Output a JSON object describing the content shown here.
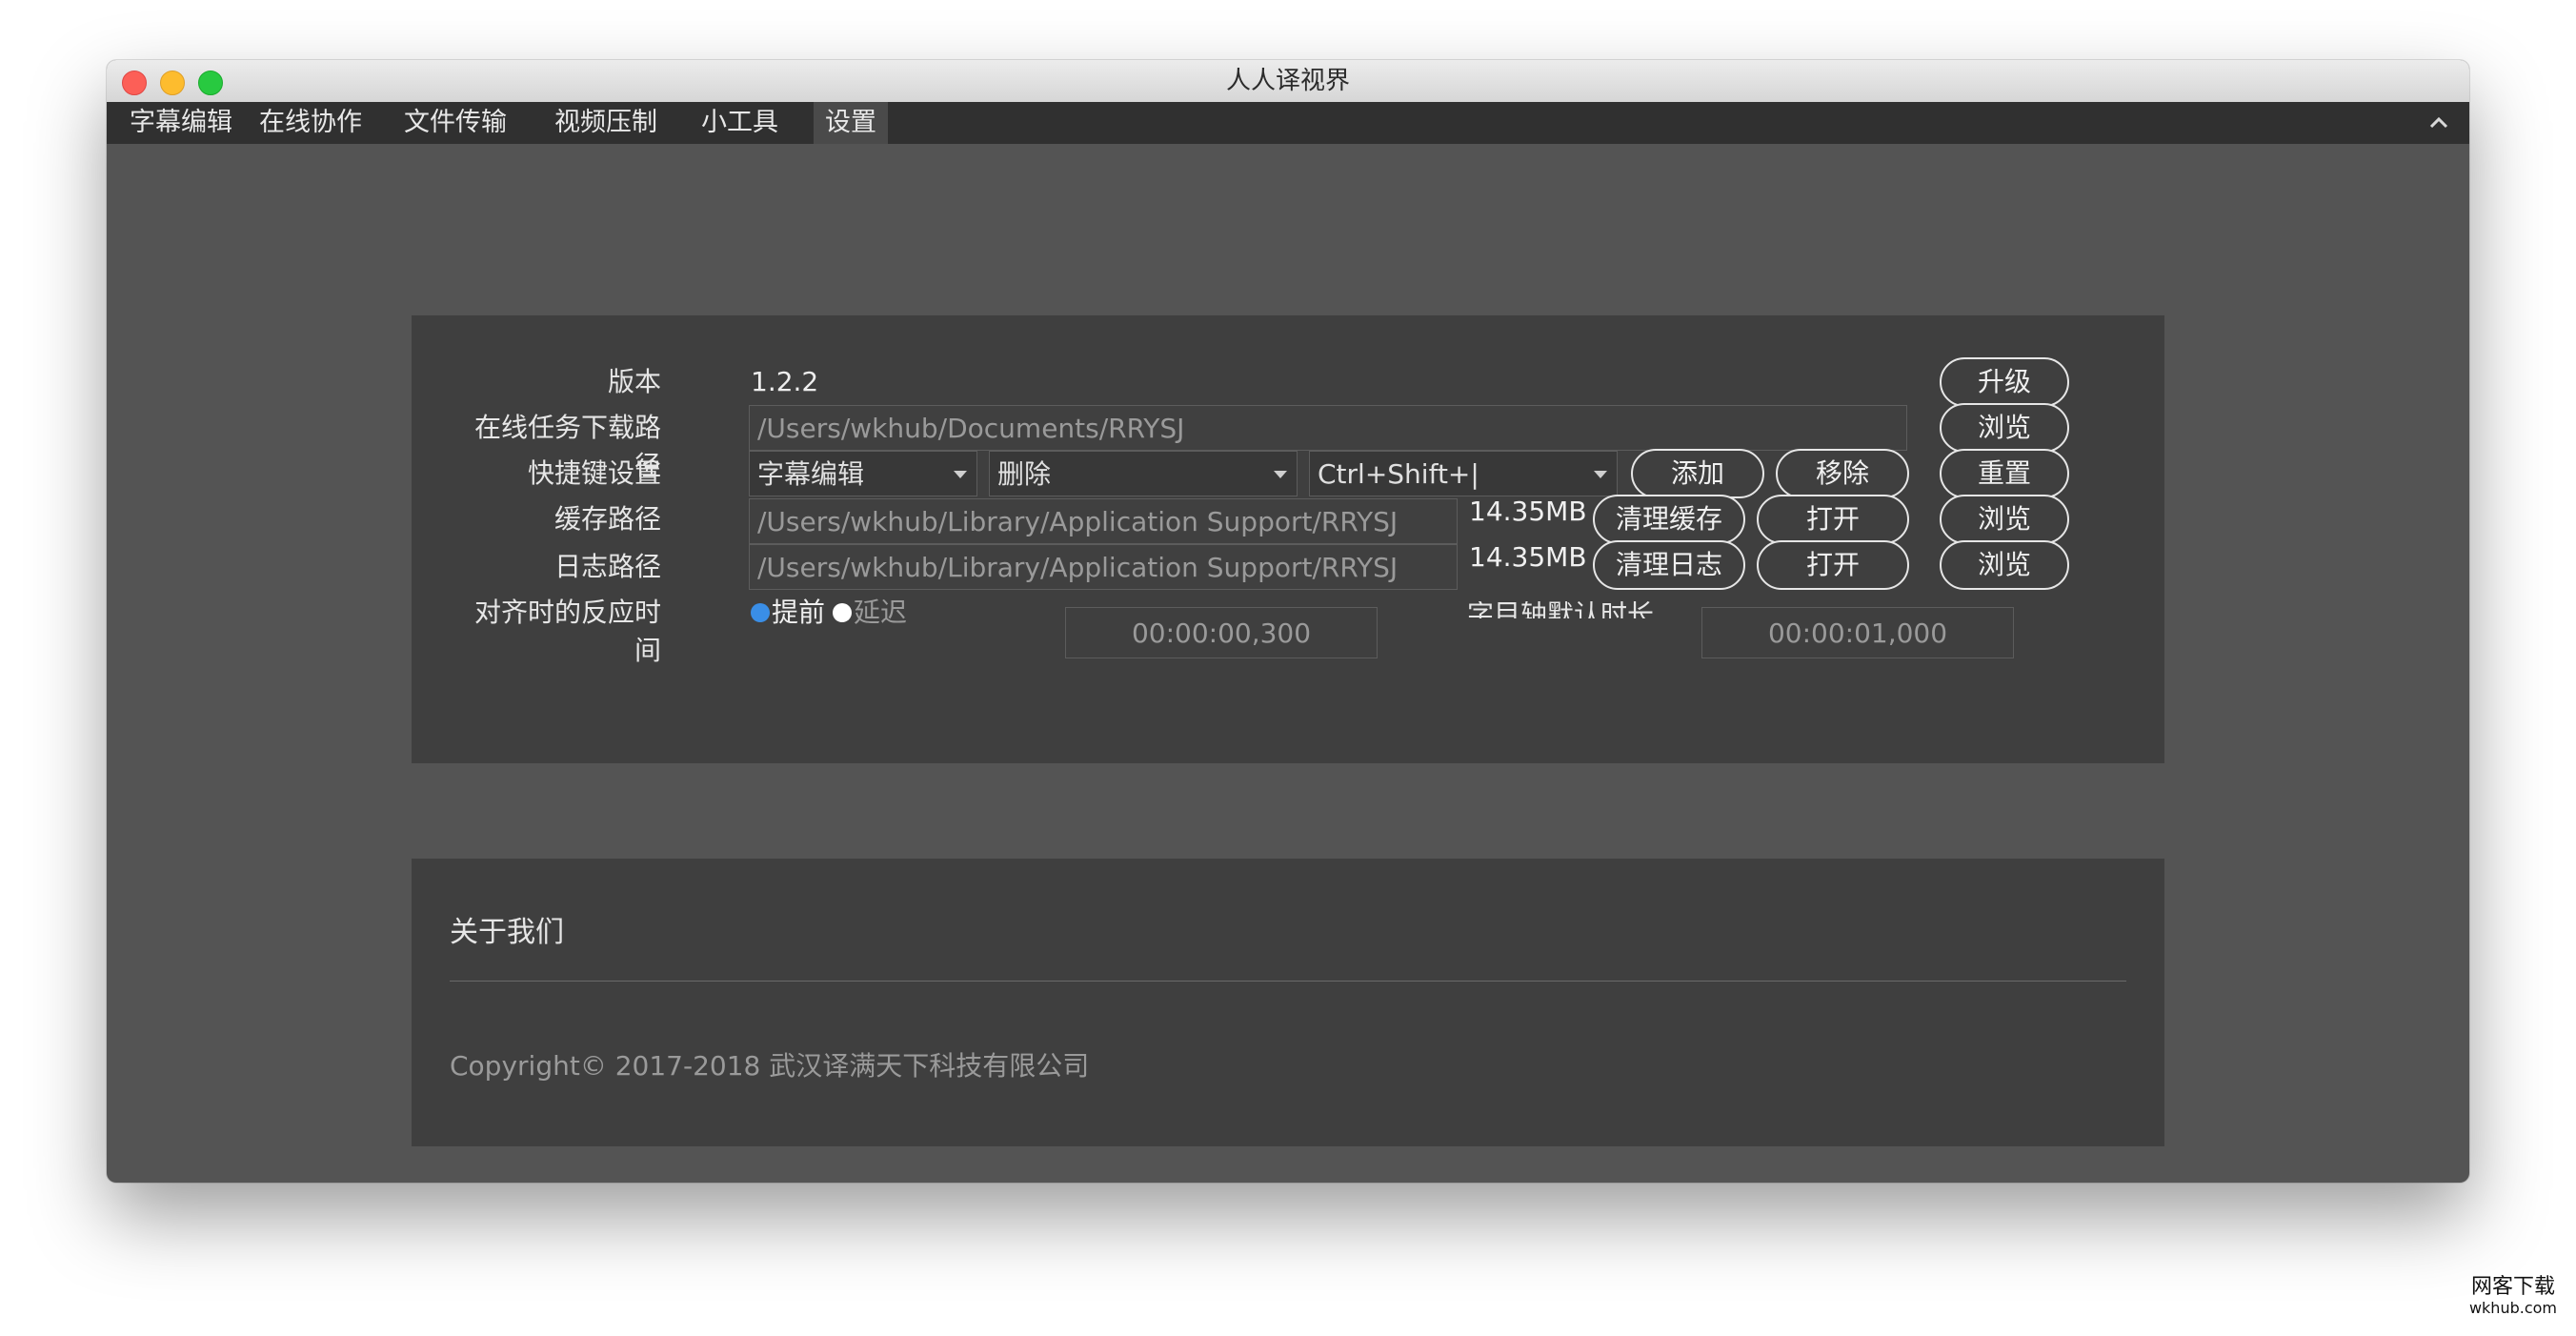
{
  "window": {
    "title": "人人译视界"
  },
  "menu": {
    "items": [
      "字幕编辑",
      "在线协作",
      "文件传输",
      "视频压制",
      "小工具",
      "设置"
    ],
    "active": "设置"
  },
  "settings": {
    "version_label": "版本",
    "version_value": "1.2.2",
    "upgrade_button": "升级",
    "download_path_label": "在线任务下载路径",
    "download_path_value": "/Users/wkhub/Documents/RRYSJ",
    "download_browse_button": "浏览",
    "shortcut_label": "快捷键设置",
    "shortcut_module": "字幕编辑",
    "shortcut_action": "删除",
    "shortcut_keys": "Ctrl+Shift+|",
    "shortcut_add_button": "添加",
    "shortcut_remove_button": "移除",
    "shortcut_reset_button": "重置",
    "cache_path_label": "缓存路径",
    "cache_path_value": "/Users/wkhub/Library/Application Support/RRYSJ",
    "cache_size": "14.35MB",
    "cache_clear_button": "清理缓存",
    "cache_open_button": "打开",
    "cache_browse_button": "浏览",
    "log_path_label": "日志路径",
    "log_path_value": "/Users/wkhub/Library/Application Support/RRYSJ",
    "log_size": "14.35MB",
    "log_clear_button": "清理日志",
    "log_open_button": "打开",
    "log_browse_button": "浏览",
    "align_label": "对齐时的反应时间",
    "align_option_before": "提前",
    "align_option_delay": "延迟",
    "align_time_value": "00:00:00,300",
    "default_duration_label": "字目轴默认时长",
    "default_duration_value": "00:00:01,000"
  },
  "about": {
    "title": "关于我们",
    "copyright": "Copyright© 2017-2018 武汉译满天下科技有限公司"
  },
  "watermark": {
    "line1": "网客下载",
    "line2": "wkhub.com"
  },
  "colors": {
    "background": "#545454",
    "panel": "#3f3f3f",
    "menubar": "#303030",
    "radio_selected": "#3a8ee6",
    "radio_unselected": "#ffffff"
  }
}
